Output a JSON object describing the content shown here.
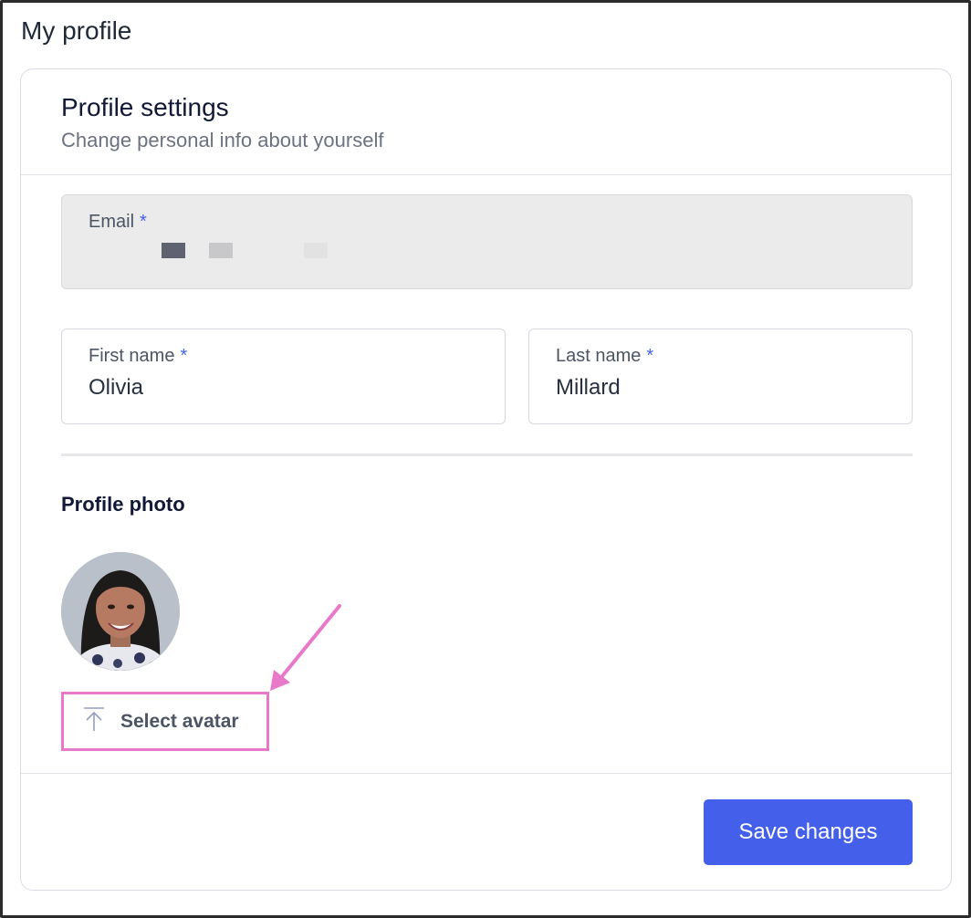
{
  "page": {
    "title": "My profile"
  },
  "card": {
    "title": "Profile settings",
    "subtitle": "Change personal info about yourself"
  },
  "form": {
    "email": {
      "label": "Email",
      "required_mark": "*"
    },
    "first_name": {
      "label": "First name",
      "required_mark": "*",
      "value": "Olivia"
    },
    "last_name": {
      "label": "Last name",
      "required_mark": "*",
      "value": "Millard"
    }
  },
  "profile_photo": {
    "section_title": "Profile photo",
    "select_button_label": "Select avatar",
    "upload_icon": "upload-icon"
  },
  "footer": {
    "save_label": "Save changes"
  },
  "colors": {
    "accent": "#4460ea",
    "required": "#4361ee",
    "annotation": "#e879c9"
  }
}
